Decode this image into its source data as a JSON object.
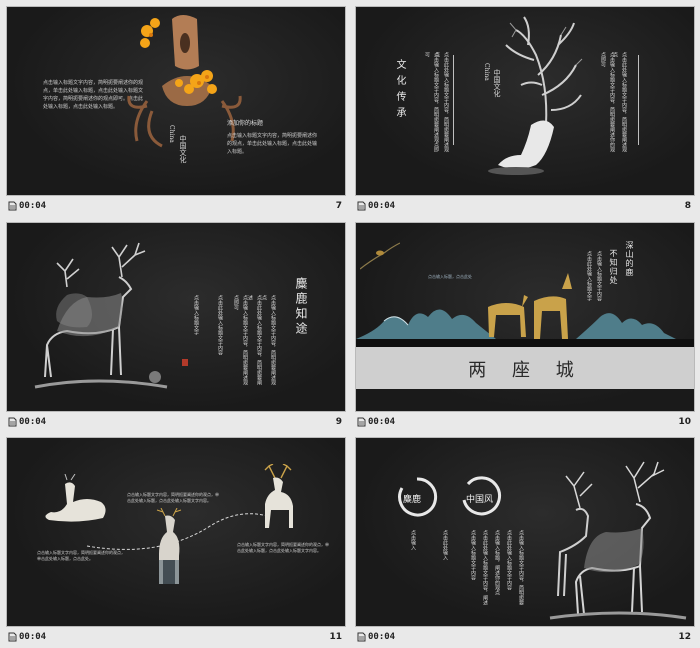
{
  "slides": [
    {
      "time": "00:04",
      "number": "7",
      "body_left": "点击输入标题文字内容，简明扼要阐述你的观点，单击此处输入标题，点击此处输入标题文字内容，简明扼要阐述你的观点即可。点击此处输入标题，点击此处输入标题。",
      "chinese_culture": "中国文化",
      "china_en": "China",
      "subtitle": "添加你的标题",
      "body_right": "点击输入标题文字内容，简明扼要阐述你的观点，单击此处输入标题，点击此处输入标题。"
    },
    {
      "time": "00:04",
      "number": "8",
      "title": "文化传承",
      "chinese_culture": "中国文化",
      "china_en": "China",
      "col_a": "点击输入标题文字内容，简明扼要阐述观点即可",
      "col_b": "点击此处输入标题文字内容，简明扼要阐述观点",
      "col_c": "点击输入标题文字内容，简明扼要阐述你的观点即可",
      "col_d": "点击此处输入标题文字内容，简明扼要阐述观点"
    },
    {
      "time": "00:04",
      "number": "9",
      "title": "麋鹿知途",
      "col_a": "点击输入标题文字内容，简明扼要阐述观点",
      "col_b": "点击此处输入标题文字内容，简明扼要阐述",
      "col_c": "点击输入标题文字内容，简明扼要阐述观点即可",
      "col_d": "点击此处输入标题文字内容",
      "col_e": "点击输入标题文字"
    },
    {
      "time": "00:04",
      "number": "10",
      "banner": "两 座 城",
      "poem_a": "深山的鹿",
      "poem_b": "不知归处",
      "col_a": "点击输入标题文字内容",
      "col_b": "点击此处输入标题文字",
      "small_line": "点击输入标题，点击此处"
    },
    {
      "time": "00:04",
      "number": "11",
      "text_top": "点击输入标题文字内容，简明扼要阐述你的观点，单击此处输入标题，点击此处输入标题文字内容。",
      "text_left": "点击输入标题文字内容，简明扼要阐述你的观点，单击此处输入标题，点击此处。",
      "text_right": "点击输入标题文字内容，简明扼要阐述你的观点，单击此处输入标题，点击此处输入标题文字内容。"
    },
    {
      "time": "00:04",
      "number": "12",
      "label_a": "麋鹿",
      "label_b": "中国风",
      "col_a": "点击输入标题文字内容，简明扼要",
      "col_b": "点击此处输入标题文字内容",
      "col_c": "点击输入标题，阐述你的观点",
      "col_d": "点击此处输入标题文字内容，阐述",
      "col_e": "点击输入标题文字内容",
      "col_f": "点击此处输入",
      "col_g": "点击输入"
    }
  ]
}
